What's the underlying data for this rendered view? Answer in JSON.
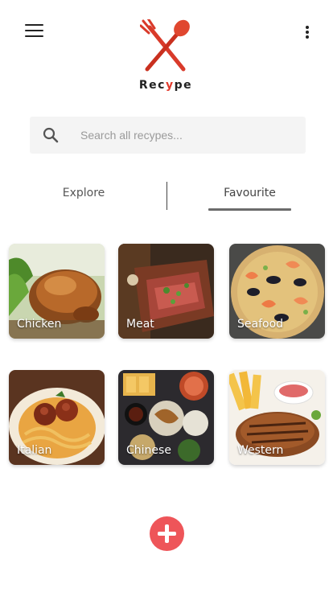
{
  "header": {
    "menu_icon": "hamburger-menu-icon",
    "more_icon": "more-vertical-icon",
    "logo": {
      "icon": "crossed-fork-spoon-icon",
      "text_before": "Rec",
      "text_accent": "y",
      "text_after": "pe",
      "accent_color": "#e23a2c"
    }
  },
  "search": {
    "icon": "search-icon",
    "placeholder": "Search all recypes...",
    "value": ""
  },
  "tabs": [
    {
      "label": "Explore",
      "active": false
    },
    {
      "label": "Favourite",
      "active": true
    }
  ],
  "categories": [
    {
      "label": "Chicken",
      "image": "roast-chicken-photo"
    },
    {
      "label": "Meat",
      "image": "sliced-steak-photo"
    },
    {
      "label": "Seafood",
      "image": "seafood-paella-photo"
    },
    {
      "label": "Italian",
      "image": "spaghetti-meatballs-photo"
    },
    {
      "label": "Chinese",
      "image": "chinese-dishes-photo"
    },
    {
      "label": "Western",
      "image": "grilled-steak-fries-photo"
    }
  ],
  "fab": {
    "icon": "plus-icon",
    "color": "#ee5559"
  }
}
